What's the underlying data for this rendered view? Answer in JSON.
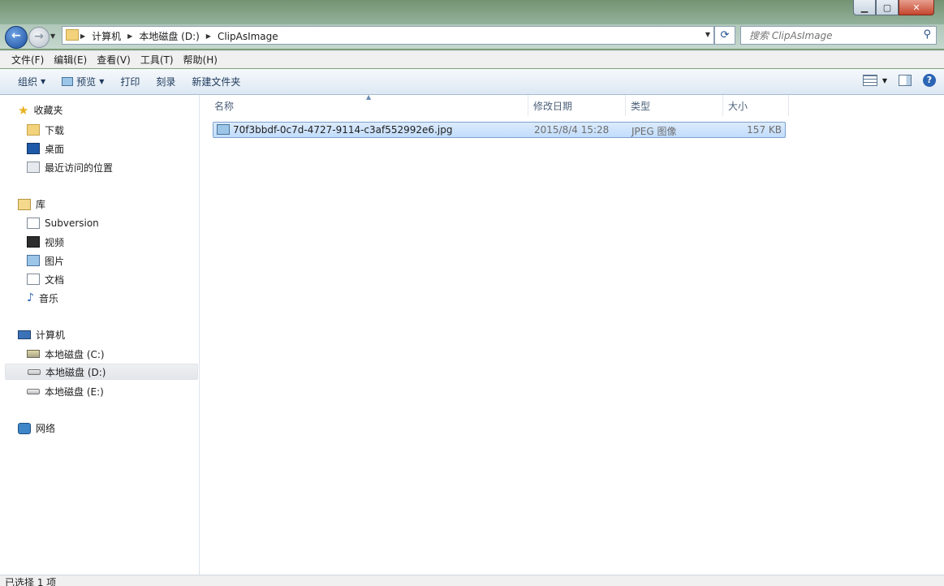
{
  "window": {
    "caption_buttons": {
      "minimize": "▁",
      "maximize": "▢",
      "close": "✕"
    }
  },
  "address": {
    "crumbs": [
      "计算机",
      "本地磁盘 (D:)",
      "ClipAsImage"
    ],
    "search_placeholder": "搜索 ClipAsImage"
  },
  "menu": [
    "文件(F)",
    "编辑(E)",
    "查看(V)",
    "工具(T)",
    "帮助(H)"
  ],
  "toolbar": {
    "organize": "组织",
    "preview": "预览",
    "print": "打印",
    "burn": "刻录",
    "new_folder": "新建文件夹"
  },
  "nav": {
    "favorites": {
      "label": "收藏夹",
      "items": [
        "下载",
        "桌面",
        "最近访问的位置"
      ]
    },
    "libraries": {
      "label": "库",
      "items": [
        "Subversion",
        "视频",
        "图片",
        "文档",
        "音乐"
      ]
    },
    "computer": {
      "label": "计算机",
      "items": [
        "本地磁盘 (C:)",
        "本地磁盘 (D:)",
        "本地磁盘 (E:)"
      ],
      "selected": "本地磁盘 (D:)"
    },
    "network": {
      "label": "网络"
    }
  },
  "columns": [
    "名称",
    "修改日期",
    "类型",
    "大小"
  ],
  "files": [
    {
      "name": "70f3bbdf-0c7d-4727-9114-c3af552992e6.jpg",
      "modified": "2015/8/4 15:28",
      "type": "JPEG 图像",
      "size": "157 KB",
      "selected": true
    }
  ],
  "status": "已选择 1 项",
  "colors": {
    "selection": "#c1dcfc",
    "command_bar": "#dde8f3"
  }
}
